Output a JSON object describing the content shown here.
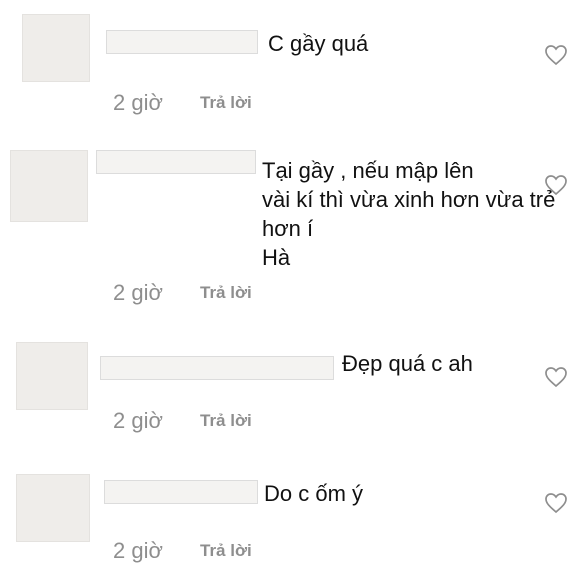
{
  "comments": [
    {
      "text": "C gầy quá",
      "time": "2 giờ",
      "reply_label": "Trả lời",
      "like_icon": "heart-outline-icon"
    },
    {
      "text": "Tại gầy , nếu mập lên\nvài kí thì vừa xinh hơn vừa trẻ hơn í\nHà",
      "time": "2 giờ",
      "reply_label": "Trả lời",
      "like_icon": "heart-outline-icon"
    },
    {
      "text": "Đẹp quá c ah",
      "time": "2 giờ",
      "reply_label": "Trả lời",
      "like_icon": "heart-outline-icon"
    },
    {
      "text": "Do c ốm ý",
      "time": "2 giờ",
      "reply_label": "Trả lời",
      "like_icon": "heart-outline-icon"
    }
  ]
}
